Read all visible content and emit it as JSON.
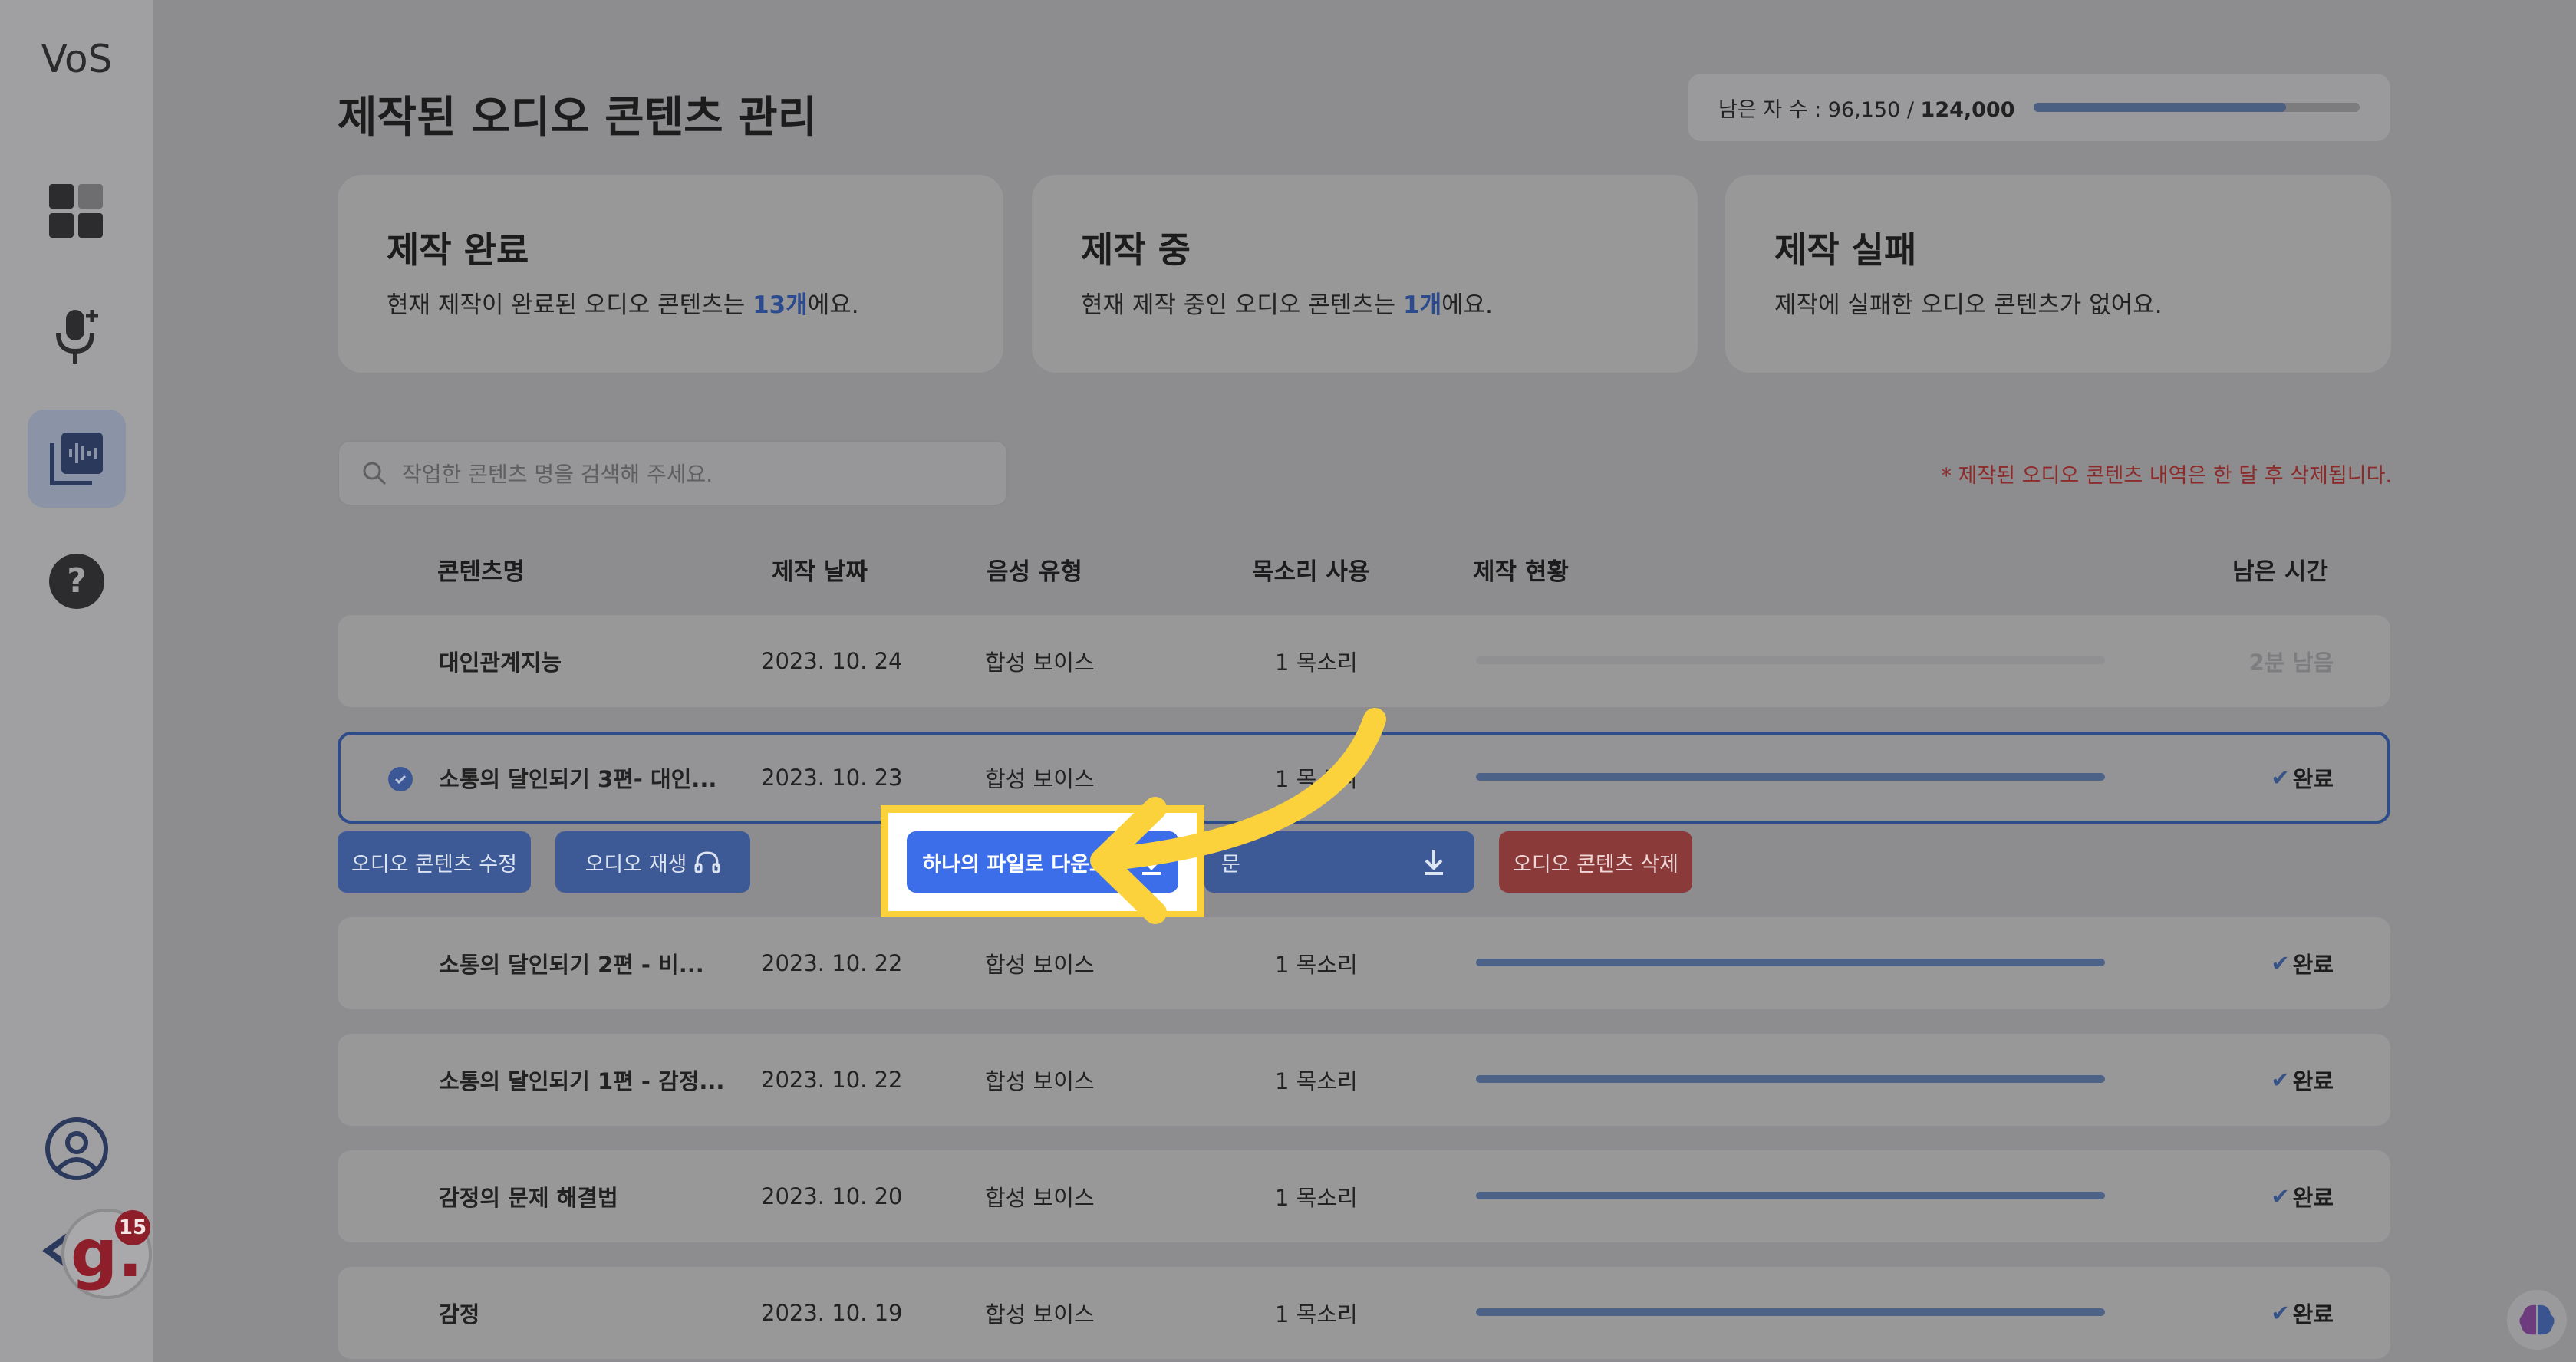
{
  "sidebar": {
    "logo": "VoS",
    "items": [
      {
        "icon": "dashboard-grid-icon"
      },
      {
        "icon": "microphone-add-icon"
      },
      {
        "icon": "audio-library-icon",
        "active": true
      },
      {
        "icon": "help-question-icon"
      }
    ],
    "profile_icon": "user-profile-icon",
    "collapse_icon": "chevron-left-icon"
  },
  "header": {
    "title": "제작된 오디오 콘텐츠 관리",
    "quota": {
      "label": "남은 자 수 : 96,150 / ",
      "total": "124,000",
      "fraction_used": 0.775
    }
  },
  "summary": [
    {
      "title": "제작 완료",
      "before": "현재 제작이 완료된 오디오 콘텐츠는 ",
      "highlight": "13개",
      "after": "에요."
    },
    {
      "title": "제작 중",
      "before": "현재 제작 중인 오디오 콘텐츠는 ",
      "highlight": "1개",
      "after": "에요."
    },
    {
      "title": "제작 실패",
      "before": "제작에 실패한 오디오 콘텐츠가 없어요.",
      "highlight": "",
      "after": ""
    }
  ],
  "search": {
    "placeholder": "작업한 콘텐츠 명을 검색해 주세요."
  },
  "notice": "* 제작된 오디오 콘텐츠 내역은 한 달 후 삭제됩니다.",
  "table": {
    "headers": {
      "name": "콘텐츠명",
      "date": "제작 날짜",
      "type": "음성 유형",
      "voices": "목소리 사용",
      "progress": "제작 현황",
      "remaining": "남은 시간"
    },
    "rows": [
      {
        "name": "대인관계지능",
        "date": "2023. 10. 24",
        "type": "합성 보이스",
        "voices": "1 목소리",
        "status": "2분 남음",
        "done": false
      },
      {
        "name": "소통의 달인되기 3편- 대인...",
        "date": "2023. 10. 23",
        "type": "합성 보이스",
        "voices": "1 목소리",
        "status": "완료",
        "done": true,
        "selected": true
      },
      {
        "name": "소통의 달인되기 2편 - 비...",
        "date": "2023. 10. 22",
        "type": "합성 보이스",
        "voices": "1 목소리",
        "status": "완료",
        "done": true
      },
      {
        "name": "소통의 달인되기 1편 - 감정...",
        "date": "2023. 10. 22",
        "type": "합성 보이스",
        "voices": "1 목소리",
        "status": "완료",
        "done": true
      },
      {
        "name": "감정의 문제 해결법",
        "date": "2023. 10. 20",
        "type": "합성 보이스",
        "voices": "1 목소리",
        "status": "완료",
        "done": true
      },
      {
        "name": "감정",
        "date": "2023. 10. 19",
        "type": "합성 보이스",
        "voices": "1 목소리",
        "status": "완료",
        "done": true
      }
    ]
  },
  "actions": {
    "edit": "오디오 콘텐츠 수정",
    "play": "오디오 재생",
    "download_single": "하나의 파일로 다운로드",
    "download_multi_partial": "문",
    "delete": "오디오 콘텐츠 삭제"
  },
  "notification": {
    "avatar_letter": "g.",
    "count": "15"
  },
  "colors": {
    "accent": "#3b6ee8",
    "highlight": "#fbd23c",
    "delete": "#8b3a3a",
    "overlay": "#8d8d8f"
  }
}
